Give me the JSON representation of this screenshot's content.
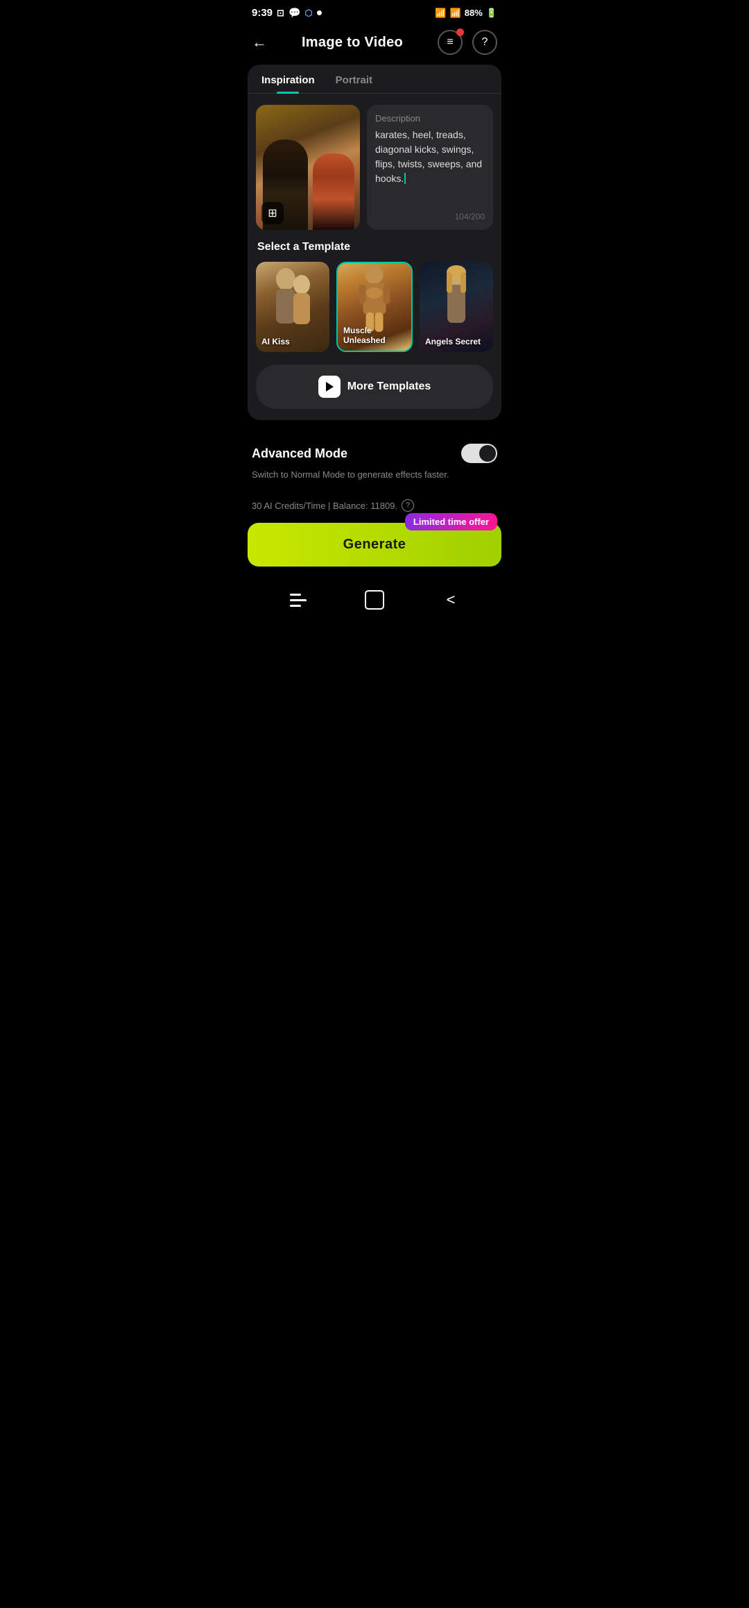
{
  "statusBar": {
    "time": "9:39",
    "battery": "88%"
  },
  "header": {
    "title": "Image to Video",
    "backArrow": "←"
  },
  "tabs": [
    {
      "id": "inspiration",
      "label": "Inspiration",
      "active": true
    },
    {
      "id": "portrait",
      "label": "Portrait",
      "active": false
    }
  ],
  "description": {
    "label": "Description",
    "text": "karates, heel, treads, diagonal kicks, swings, flips, twists, sweeps, and hooks.",
    "charCount": "104/200"
  },
  "templateSection": {
    "label": "Select a Template",
    "templates": [
      {
        "id": "ai-kiss",
        "label": "AI Kiss",
        "selected": false
      },
      {
        "id": "muscle-unleashed",
        "label": "Muscle Unleashed",
        "selected": true
      },
      {
        "id": "angels-secret",
        "label": "Angels Secret",
        "selected": false
      }
    ]
  },
  "moreTemplatesBtn": {
    "label": "More Templates"
  },
  "advancedMode": {
    "title": "Advanced Mode",
    "description": "Switch to Normal Mode to generate effects faster.",
    "enabled": true
  },
  "credits": {
    "text": "30 AI Credits/Time | Balance: 11809."
  },
  "generateBtn": {
    "label": "Generate",
    "limitedOffer": "Limited time offer"
  },
  "navBar": {
    "home": "□",
    "back": "<"
  }
}
